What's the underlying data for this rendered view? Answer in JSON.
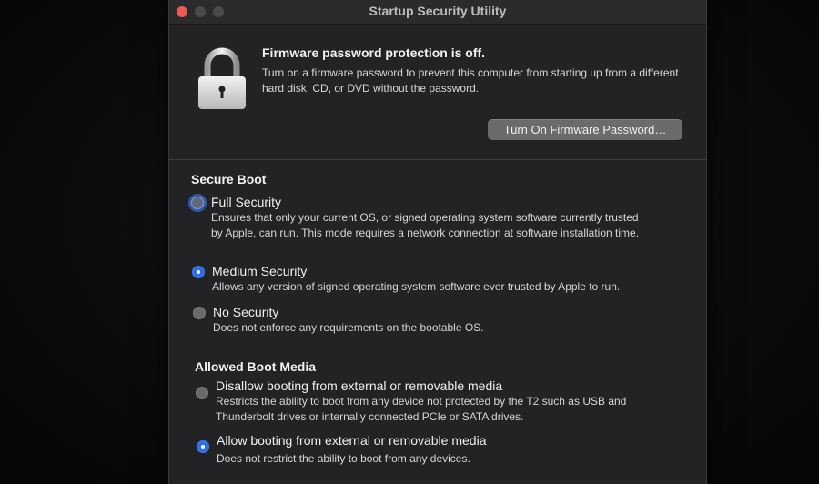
{
  "window": {
    "title": "Startup Security Utility"
  },
  "firmware": {
    "heading": "Firmware password protection is off.",
    "description": "Turn on a firmware password to prevent this computer from starting up from a different hard disk, CD, or DVD without the password.",
    "button_label": "Turn On Firmware Password…"
  },
  "secure_boot": {
    "title": "Secure Boot",
    "options": [
      {
        "label": "Full Security",
        "description": "Ensures that only your current OS, or signed operating system software currently trusted by Apple, can run. This mode requires a network connection at software installation time.",
        "selected": false
      },
      {
        "label": "Medium Security",
        "description": "Allows any version of signed operating system software ever trusted by Apple to run.",
        "selected": true
      },
      {
        "label": "No Security",
        "description": "Does not enforce any requirements on the bootable OS.",
        "selected": false
      }
    ]
  },
  "boot_media": {
    "title": "Allowed Boot Media",
    "options": [
      {
        "label": "Disallow booting from external or removable media",
        "description": "Restricts the ability to boot from any device not protected by the T2 such as USB and Thunderbolt drives or internally connected PCIe or SATA drives.",
        "selected": false
      },
      {
        "label": "Allow booting from external or removable media",
        "description": "Does not restrict the ability to boot from any devices.",
        "selected": true
      }
    ]
  },
  "colors": {
    "accent": "#2f6fe6",
    "window_bg": "#232325",
    "close_button": "#ee5a52"
  },
  "icons": {
    "lock": "padlock-icon"
  }
}
